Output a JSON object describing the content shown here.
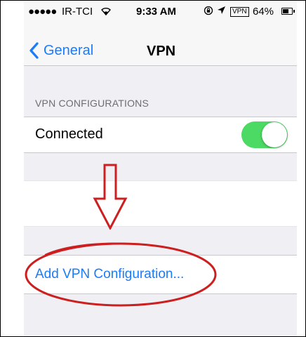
{
  "status_bar": {
    "signal": "●●●●●",
    "carrier": "IR-TCI",
    "wifi_icon": "wifi-icon",
    "time": "9:33 AM",
    "lock_icon": "orientation-lock-icon",
    "location_icon": "location-arrow-icon",
    "vpn_badge": "VPN",
    "battery_percent": "64%",
    "battery_level": 0.64
  },
  "nav": {
    "back_label": "General",
    "title": "VPN"
  },
  "section": {
    "header": "VPN CONFIGURATIONS"
  },
  "connection": {
    "label": "Connected",
    "toggle_on": true
  },
  "add_config": {
    "label": "Add VPN Configuration..."
  },
  "colors": {
    "ios_blue": "#1a7cfa",
    "toggle_green": "#4cd964",
    "annotation_red": "#cc1f1f",
    "group_bg": "#efeff4"
  },
  "annotations": {
    "arrow": "down-arrow-outline",
    "ellipse": "red-ellipse-highlight"
  }
}
